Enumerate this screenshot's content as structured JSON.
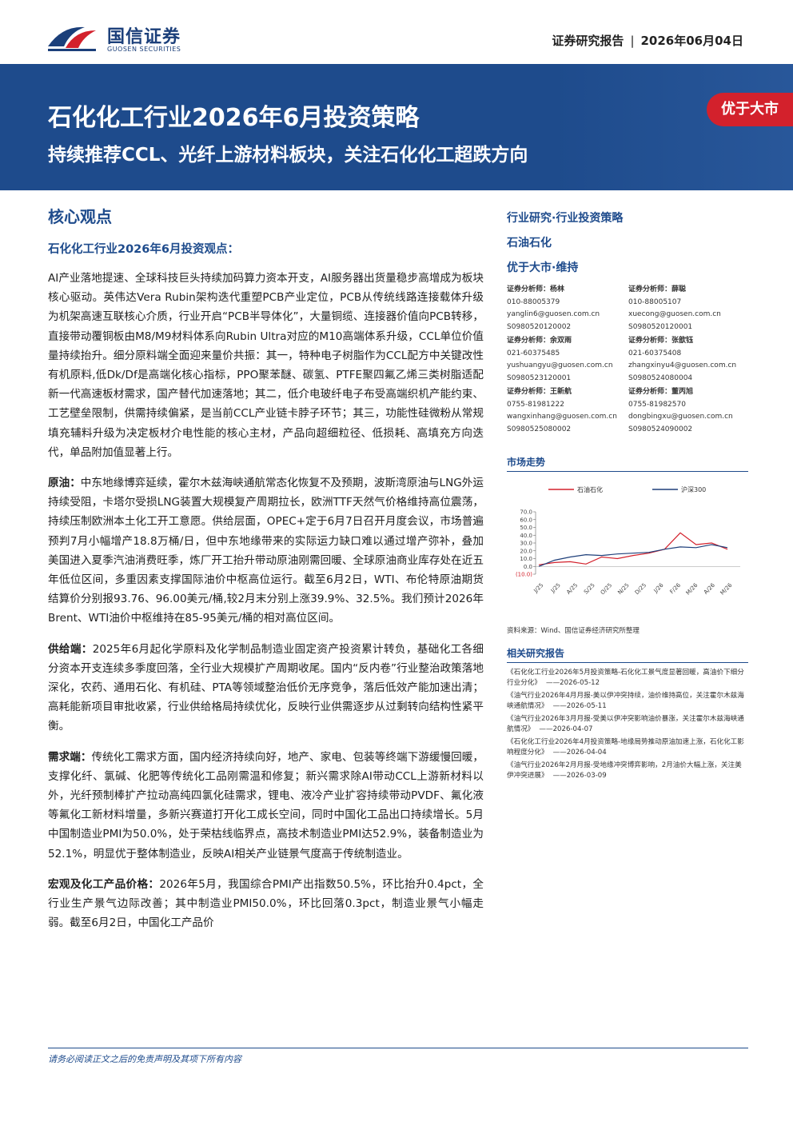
{
  "header": {
    "logo_cn": "国信证券",
    "logo_en": "GUOSEN SECURITIES",
    "report_type": "证券研究报告",
    "date": "2026年06月04日"
  },
  "banner": {
    "title": "石化化工行业2026年6月投资策略",
    "subtitle": "持续推荐CCL、光纤上游材料板块，关注石化化工超跌方向",
    "rating": "优于大市"
  },
  "core": {
    "heading": "核心观点",
    "subheading": "石化化工行业2026年6月投资观点：",
    "paragraphs": [
      {
        "lead": "",
        "text": "AI产业落地提速、全球科技巨头持续加码算力资本开支，AI服务器出货量稳步高增成为板块核心驱动。英伟达Vera Rubin架构迭代重塑PCB产业定位，PCB从传统线路连接载体升级为机架高速互联核心介质，行业开启“PCB半导体化”，大量铜缆、连接器价值向PCB转移，直接带动覆铜板由M8/M9材料体系向Rubin Ultra对应的M10高端体系升级，CCL单位价值量持续抬升。细分原料端全面迎来量价共振：其一，特种电子树脂作为CCL配方中关键改性有机原料,低Dk/Df是高端化核心指标，PPO聚苯醚、碳氢、PTFE聚四氟乙烯三类树脂适配新一代高速板材需求，国产替代加速落地；其二，低介电玻纤电子布受高端织机产能约束、工艺壁垒限制，供需持续偏紧，是当前CCL产业链卡脖子环节；其三，功能性硅微粉从常规填充辅料升级为决定板材介电性能的核心主材，产品向超细粒径、低损耗、高填充方向迭代，单品附加值显著上行。"
      },
      {
        "lead": "原油：",
        "text": "中东地缘博弈延续，霍尔木兹海峡通航常态化恢复不及预期，波斯湾原油与LNG外运持续受阻，卡塔尔受损LNG装置大规模复产周期拉长，欧洲TTF天然气价格维持高位震荡，持续压制欧洲本土化工开工意愿。供给层面，OPEC+定于6月7日召开月度会议，市场普遍预判7月小幅增产18.8万桶/日，但中东地缘带来的实际运力缺口难以通过增产弥补，叠加美国进入夏季汽油消费旺季，炼厂开工抬升带动原油刚需回暖、全球原油商业库存处在近五年低位区间，多重因素支撑国际油价中枢高位运行。截至6月2日，WTI、布伦特原油期货结算价分别报93.76、96.00美元/桶,较2月末分别上涨39.9%、32.5%。我们预计2026年Brent、WTI油价中枢维持在85-95美元/桶的相对高位区间。"
      },
      {
        "lead": "供给端：",
        "text": "2025年6月起化学原料及化学制品制造业固定资产投资累计转负，基础化工各细分资本开支连续多季度回落，全行业大规模扩产周期收尾。国内“反内卷”行业整治政策落地深化，农药、通用石化、有机硅、PTA等领域整治低价无序竞争，落后低效产能加速出清；高耗能新项目审批收紧，行业供给格局持续优化，反映行业供需逐步从过剩转向结构性紧平衡。"
      },
      {
        "lead": "需求端：",
        "text": "传统化工需求方面，国内经济持续向好，地产、家电、包装等终端下游缓慢回暖，支撑化纤、氯碱、化肥等传统化工品刚需温和修复；新兴需求除AI带动CCL上游新材料以外，光纤预制棒扩产拉动高纯四氯化硅需求，锂电、液冷产业扩容持续带动PVDF、氟化液等氟化工新材料增量，多新兴赛道打开化工成长空间，同时中国化工品出口持续增长。5月中国制造业PMI为50.0%，处于荣枯线临界点，高技术制造业PMI达52.9%，装备制造业为52.1%，明显优于整体制造业，反映AI相关产业链景气度高于传统制造业。"
      },
      {
        "lead": "宏观及化工产品价格：",
        "text": "2026年5月，我国综合PMI产出指数50.5%，环比抬升0.4pct，全行业生产景气边际改善；其中制造业PMI50.0%，环比回落0.3pct，制造业景气小幅走弱。截至6月2日，中国化工产品价"
      }
    ]
  },
  "side": {
    "lines": [
      "行业研究·行业投资策略",
      "石油石化",
      "优于大市·维持"
    ],
    "analysts": [
      {
        "name": "证券分析师：杨林",
        "phone": "010-88005379",
        "email": "yanglin6@guosen.com.cn",
        "cert": "S0980520120002"
      },
      {
        "name": "证券分析师：薛聪",
        "phone": "010-88005107",
        "email": "xuecong@guosen.com.cn",
        "cert": "S0980520120001"
      },
      {
        "name": "证券分析师：余双雨",
        "phone": "021-60375485",
        "email": "yushuangyu@guosen.com.cn",
        "cert": "S0980523120001"
      },
      {
        "name": "证券分析师：张歆钰",
        "phone": "021-60375408",
        "email": "zhangxinyu4@guosen.com.cn",
        "cert": "S0980524080004"
      },
      {
        "name": "证券分析师：王新航",
        "phone": "0755-81981222",
        "email": "wangxinhang@guosen.com.cn",
        "cert": "S0980525080002"
      },
      {
        "name": "证券分析师：董丙旭",
        "phone": "0755-81982570",
        "email": "dongbingxu@guosen.com.cn",
        "cert": "S0980524090002"
      }
    ],
    "market_heading": "市场走势",
    "chart_source": "资料来源：Wind、国信证券经济研究所整理",
    "related_heading": "相关研究报告",
    "related": [
      {
        "title": "《石化化工行业2026年5月投资策略-石化化工景气度显著回暖，高油价下细分行业分化》",
        "date": "——2026-05-12"
      },
      {
        "title": "《油气行业2026年4月月报-美以伊冲突持续，油价维持高位，关注霍尔木兹海峡通航情况》",
        "date": "——2026-05-11"
      },
      {
        "title": "《油气行业2026年3月月报-受美以伊冲突影响油价暴涨，关注霍尔木兹海峡通航情况》",
        "date": "——2026-04-07"
      },
      {
        "title": "《石化化工行业2026年4月投资策略-地缘局势推动原油加速上涨，石化化工影响程度分化》",
        "date": "——2026-04-04"
      },
      {
        "title": "《油气行业2026年2月月报-受地缘冲突博弈影响，2月油价大幅上涨，关注美伊冲突进展》",
        "date": "——2026-03-09"
      }
    ]
  },
  "chart_data": {
    "type": "line",
    "x": [
      "J/25",
      "J/25",
      "A/25",
      "S/25",
      "O/25",
      "N/25",
      "D/25",
      "J/26",
      "F/26",
      "M/26",
      "A/26",
      "M/26"
    ],
    "ylim": [
      -10,
      70
    ],
    "yticks": [
      "70.0",
      "60.0",
      "50.0",
      "40.0",
      "30.0",
      "20.0",
      "10.0",
      "0.0",
      "(10.0)"
    ],
    "series": [
      {
        "name": "石油石化",
        "color": "#d3212c",
        "values": [
          2,
          5,
          6,
          3,
          12,
          10,
          14,
          17,
          22,
          43,
          28,
          30,
          22
        ]
      },
      {
        "name": "沪深300",
        "color": "#1e3f7a",
        "values": [
          0,
          8,
          12,
          15,
          14,
          16,
          17,
          18,
          22,
          25,
          24,
          28,
          24
        ]
      }
    ]
  },
  "footer": {
    "disclaimer": "请务必阅读正文之后的免责声明及其项下所有内容"
  }
}
